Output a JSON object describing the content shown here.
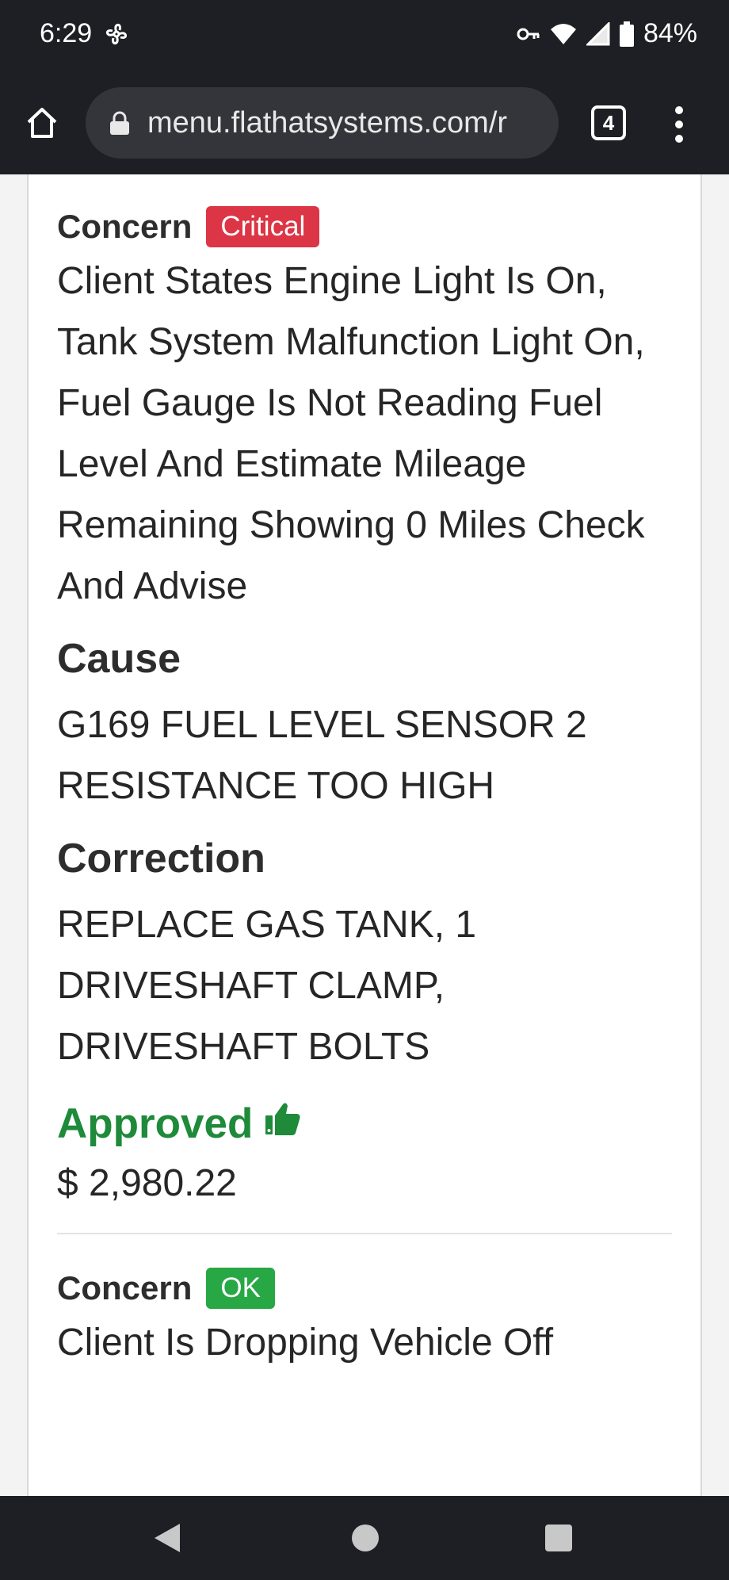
{
  "status_bar": {
    "time": "6:29",
    "battery": "84%",
    "icons": [
      "fan-icon",
      "vpn-key-icon",
      "wifi-icon",
      "signal-icon",
      "battery-icon"
    ]
  },
  "browser": {
    "url": "menu.flathatsystems.com/r",
    "tab_count": "4",
    "icons": [
      "home-icon",
      "lock-icon",
      "more-vert-icon"
    ]
  },
  "items": [
    {
      "concern_label": "Concern",
      "badge": "Critical",
      "badge_color": "#dc3545",
      "concern_text": "Client States Engine Light Is On, Tank System Malfunction Light On, Fuel Gauge Is Not Reading Fuel Level And Estimate Mileage Remaining Showing 0 Miles Check And Advise",
      "cause_label": "Cause",
      "cause_text": "G169 FUEL LEVEL SENSOR 2 RESISTANCE TOO HIGH",
      "correction_label": "Correction",
      "correction_text": "REPLACE GAS TANK, 1 DRIVESHAFT CLAMP, DRIVESHAFT BOLTS",
      "status": "Approved",
      "status_color": "#1e8a3a",
      "status_icon": "thumbs-up-icon",
      "price": "$ 2,980.22"
    },
    {
      "concern_label": "Concern",
      "badge": "OK",
      "badge_color": "#28a745",
      "concern_text": "Client Is Dropping Vehicle Off"
    }
  ]
}
